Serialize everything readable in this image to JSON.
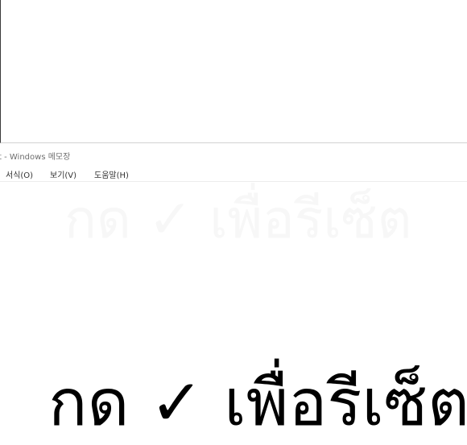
{
  "upper_window": {},
  "notepad": {
    "title": "t - Windows 메모장",
    "menu": {
      "format": "서식(O)",
      "view": "보기(V)",
      "help": "도움말(H)"
    },
    "editor": {
      "ghost_text": "กด ✓ เพื่อรีเซ็ต",
      "main_text": "กด ✓ เพื่อรีเซ็ต"
    }
  }
}
